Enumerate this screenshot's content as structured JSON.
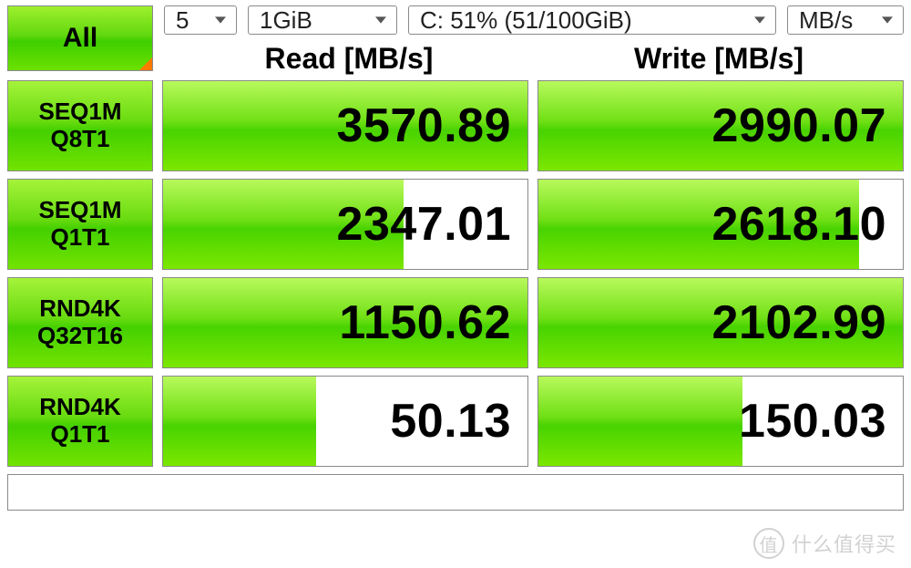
{
  "toolbar": {
    "all_label": "All",
    "runs": {
      "value": "5"
    },
    "size": {
      "value": "1GiB"
    },
    "drive": {
      "value": "C: 51% (51/100GiB)"
    },
    "units": {
      "value": "MB/s"
    }
  },
  "columns": {
    "read": "Read [MB/s]",
    "write": "Write [MB/s]"
  },
  "tests": [
    {
      "name_line1": "SEQ1M",
      "name_line2": "Q8T1",
      "read": "3570.89",
      "read_pct": 100,
      "write": "2990.07",
      "write_pct": 100
    },
    {
      "name_line1": "SEQ1M",
      "name_line2": "Q1T1",
      "read": "2347.01",
      "read_pct": 66,
      "write": "2618.10",
      "write_pct": 88
    },
    {
      "name_line1": "RND4K",
      "name_line2": "Q32T16",
      "read": "1150.62",
      "read_pct": 100,
      "write": "2102.99",
      "write_pct": 100
    },
    {
      "name_line1": "RND4K",
      "name_line2": "Q1T1",
      "read": "50.13",
      "read_pct": 42,
      "write": "150.03",
      "write_pct": 56
    }
  ],
  "watermark": "什么值得买",
  "chart_data": {
    "type": "bar",
    "title": "CrystalDiskMark-style throughput",
    "ylabel": "MB/s",
    "categories": [
      "SEQ1M Q8T1",
      "SEQ1M Q1T1",
      "RND4K Q32T16",
      "RND4K Q1T1"
    ],
    "series": [
      {
        "name": "Read",
        "values": [
          3570.89,
          2347.01,
          1150.62,
          50.13
        ]
      },
      {
        "name": "Write",
        "values": [
          2990.07,
          2618.1,
          2102.99,
          150.03
        ]
      }
    ]
  }
}
